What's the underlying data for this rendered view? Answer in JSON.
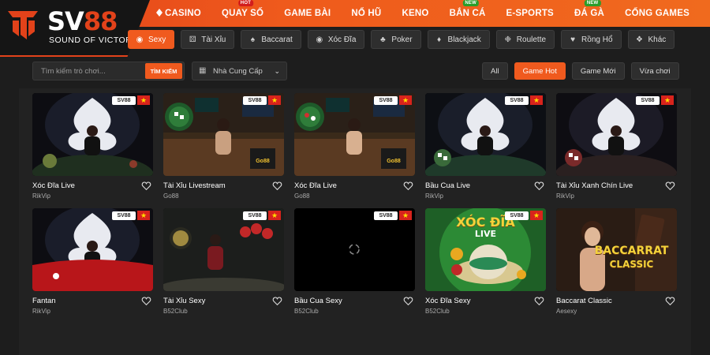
{
  "logo": {
    "brand_main": "SV",
    "brand_accent": "88",
    "tagline": "SOUND OF VICTORY"
  },
  "nav": {
    "items": [
      {
        "label": "CASINO",
        "active": true
      },
      {
        "label": "QUAY SỐ",
        "badge": "HOT"
      },
      {
        "label": "GAME BÀI"
      },
      {
        "label": "NỔ HŨ"
      },
      {
        "label": "KENO"
      },
      {
        "label": "BẮN CÁ",
        "badge": "NEW"
      },
      {
        "label": "E-SPORTS"
      },
      {
        "label": "ĐÁ GÀ",
        "badge": "NEW"
      },
      {
        "label": "CỔNG GAMES"
      }
    ]
  },
  "categories": [
    {
      "label": "Sexy",
      "icon": "lips-icon",
      "active": true
    },
    {
      "label": "Tài Xỉu",
      "icon": "dice-icon"
    },
    {
      "label": "Baccarat",
      "icon": "cards-icon"
    },
    {
      "label": "Xóc Đĩa",
      "icon": "plate-icon"
    },
    {
      "label": "Poker",
      "icon": "poker-icon"
    },
    {
      "label": "Blackjack",
      "icon": "blackjack-icon"
    },
    {
      "label": "Roulette",
      "icon": "roulette-icon"
    },
    {
      "label": "Rồng Hổ",
      "icon": "dragon-icon"
    },
    {
      "label": "Khác",
      "icon": "puzzle-icon"
    }
  ],
  "search": {
    "placeholder": "Tìm kiếm trò chơi...",
    "button": "TÌM KIẾM"
  },
  "provider_select": {
    "label": "Nhà Cung Cấp"
  },
  "filters": [
    {
      "label": "All"
    },
    {
      "label": "Game Hot",
      "active": true
    },
    {
      "label": "Game Mới"
    },
    {
      "label": "Vừa chơi"
    }
  ],
  "badge_text": "SV88",
  "games": [
    {
      "title": "Xóc Đĩa Live",
      "provider": "RikVip",
      "theme": "dealer-dark"
    },
    {
      "title": "Tài Xỉu Livestream",
      "provider": "Go88",
      "theme": "studio"
    },
    {
      "title": "Xóc Đĩa Live",
      "provider": "Go88",
      "theme": "studio"
    },
    {
      "title": "Bầu Cua Live",
      "provider": "RikVip",
      "theme": "dealer-green"
    },
    {
      "title": "Tài Xỉu Xanh Chín Live",
      "provider": "RikVip",
      "theme": "dealer-red"
    },
    {
      "title": "Fantan",
      "provider": "RikVip",
      "theme": "dealer-redtable"
    },
    {
      "title": "Tài Xỉu Sexy",
      "provider": "B52Club",
      "theme": "b52"
    },
    {
      "title": "Bầu Cua Sexy",
      "provider": "B52Club",
      "theme": "loading"
    },
    {
      "title": "Xóc Đĩa Sexy",
      "provider": "B52Club",
      "theme": "xocdia-art",
      "art_title": "XÓC ĐĨA",
      "art_sub": "LIVE"
    },
    {
      "title": "Baccarat Classic",
      "provider": "Aesexy",
      "theme": "baccarat-art",
      "art_title": "BACCARRAT",
      "art_sub": "CLASSIC"
    }
  ],
  "colors": {
    "accent": "#f05a1e",
    "nav_start": "#e2421a",
    "background": "#1d1d1d",
    "card_bg": "#222222"
  }
}
